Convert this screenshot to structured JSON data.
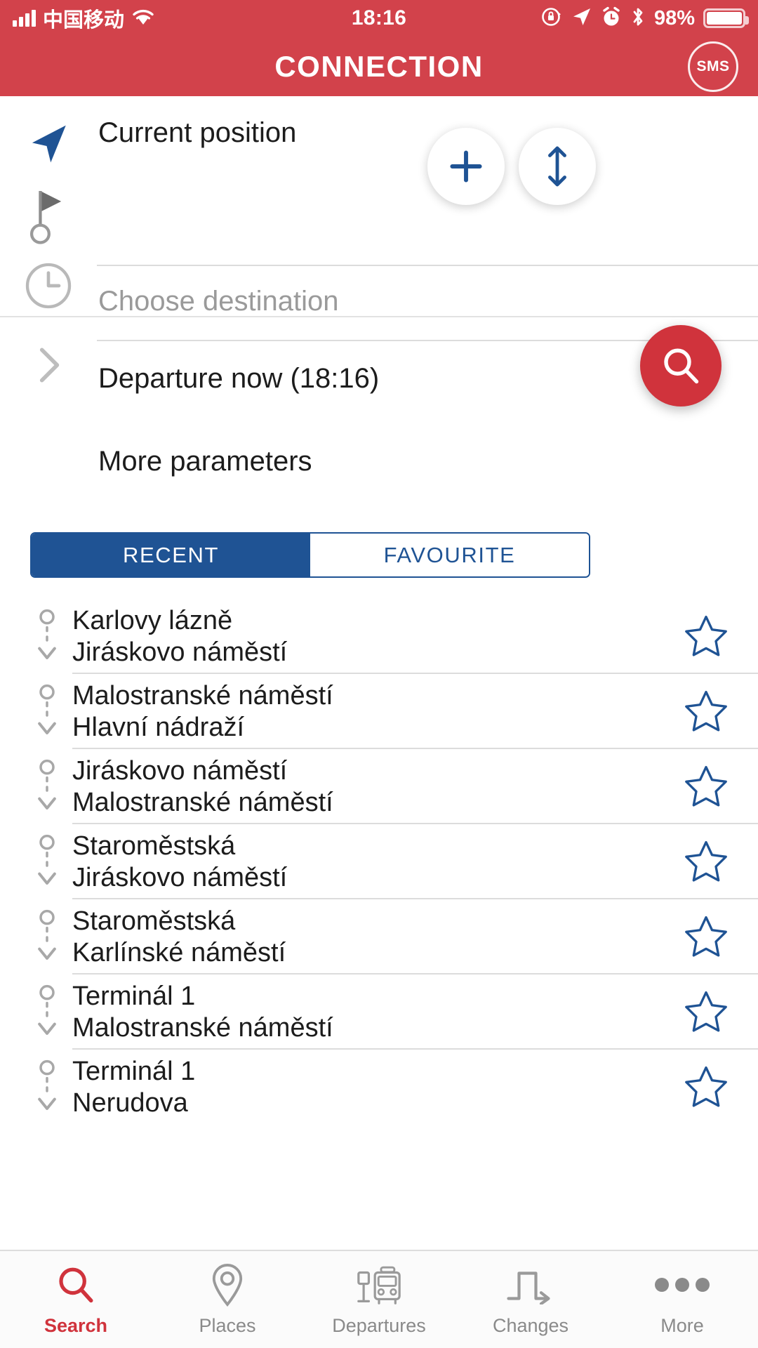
{
  "statusbar": {
    "carrier": "中国移动",
    "time": "18:16",
    "battery_percent": "98%",
    "icons": [
      "signal-bars-icon",
      "wifi-icon",
      "rotation-lock-icon",
      "location-arrow-icon",
      "alarm-clock-icon",
      "bluetooth-icon",
      "battery-icon"
    ]
  },
  "header": {
    "title": "CONNECTION",
    "sms_label": "SMS"
  },
  "form": {
    "origin_value": "Current position",
    "destination_placeholder": "Choose destination",
    "departure_label": "Departure now (18:16)",
    "more_parameters_label": "More parameters",
    "add_button_label": "+",
    "swap_button_label": "swap",
    "search_button_label": "search"
  },
  "tabs": [
    {
      "label": "RECENT",
      "active": true
    },
    {
      "label": "FAVOURITE",
      "active": false
    }
  ],
  "list": [
    {
      "from": "Karlovy lázně",
      "to": "Jiráskovo náměstí",
      "favourite": false
    },
    {
      "from": "Malostranské náměstí",
      "to": "Hlavní nádraží",
      "favourite": false
    },
    {
      "from": "Jiráskovo náměstí",
      "to": "Malostranské náměstí",
      "favourite": false
    },
    {
      "from": "Staroměstská",
      "to": "Jiráskovo náměstí",
      "favourite": false
    },
    {
      "from": "Staroměstská",
      "to": "Karlínské náměstí",
      "favourite": false
    },
    {
      "from": "Terminál 1",
      "to": "Malostranské náměstí",
      "favourite": false
    },
    {
      "from": "Terminál 1",
      "to": "Nerudova",
      "favourite": false
    }
  ],
  "bottomnav": [
    {
      "label": "Search",
      "icon": "search-icon",
      "active": true
    },
    {
      "label": "Places",
      "icon": "map-pin-icon",
      "active": false
    },
    {
      "label": "Departures",
      "icon": "bus-stop-icon",
      "active": false
    },
    {
      "label": "Changes",
      "icon": "transfer-icon",
      "active": false
    },
    {
      "label": "More",
      "icon": "ellipsis-icon",
      "active": false
    }
  ],
  "colors": {
    "brand_red": "#d2424b",
    "fab_red": "#d0333c",
    "tab_blue": "#1f5394",
    "star_blue": "#1f5394",
    "muted_gray": "#9a9a9a"
  }
}
